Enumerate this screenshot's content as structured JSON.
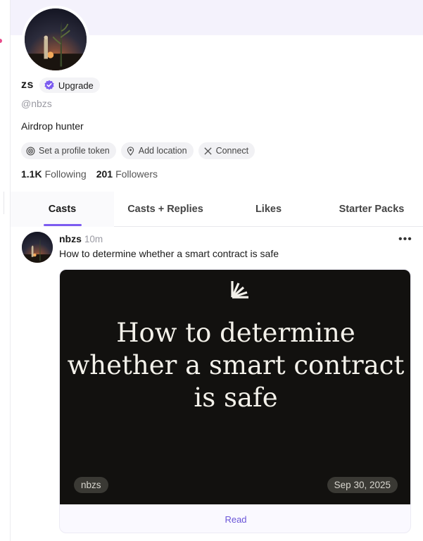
{
  "profile": {
    "display_name": "zs",
    "upgrade_label": "Upgrade",
    "handle": "@nbzs",
    "bio": "Airdrop hunter",
    "chips": {
      "token": "Set a profile token",
      "location": "Add location",
      "connect": "Connect"
    },
    "stats": {
      "following_count": "1.1K",
      "following_label": "Following",
      "followers_count": "201",
      "followers_label": "Followers"
    }
  },
  "tabs": [
    {
      "label": "Casts",
      "active": true
    },
    {
      "label": "Casts + Replies",
      "active": false
    },
    {
      "label": "Likes",
      "active": false
    },
    {
      "label": "Starter Packs",
      "active": false
    }
  ],
  "cast": {
    "user": "nbzs",
    "time": "10m",
    "more_label": "•••",
    "text": "How to determine whether a smart contract is safe",
    "card": {
      "title_lines": [
        "How to determine",
        "whether a smart contract",
        "is safe"
      ],
      "tag": "nbzs",
      "date": "Sep 30, 2025",
      "read_label": "Read"
    }
  },
  "colors": {
    "accent": "#7c5cf0",
    "cover": "#f4f2fc",
    "card_bg": "#12110f",
    "verified_badge": "#7c5cf0"
  },
  "icons": [
    "verified-badge-icon",
    "token-icon",
    "location-pin-icon",
    "x-logo-icon",
    "more-icon",
    "paragraph-logo-icon"
  ]
}
